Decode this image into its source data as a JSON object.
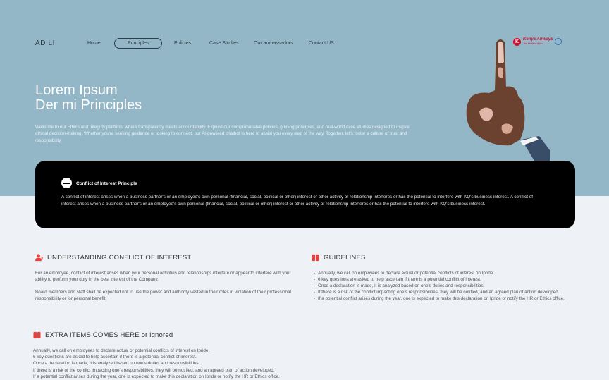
{
  "brand": "ADILI",
  "nav": {
    "items": [
      "Home",
      "Principles",
      "Policies",
      "Case Studies",
      "Our ambassadors",
      "Contact US"
    ],
    "active": "Principles"
  },
  "logo": {
    "text": "Kenya Airways",
    "tagline": "The Pride of Africa"
  },
  "hero": {
    "title_line1": "Lorem Ipsum",
    "title_line2": "Der mi Principles",
    "description": "Welcome to our Ethics and Integrity platform, where transparency meets accountability. Explore our comprehensive policies, guiding principles, and real-world case studies designed to inspire ethical decision-making. Whether you're seeking guidance or looking to connect, our AI-powered chatbot is here to assist you every step of the way. Together, let's foster a culture of trust and responsibility."
  },
  "principle_card": {
    "title": "Conflict of Interest Principle",
    "body": "A conflict of interest arises when a business partner's or an employee's own personal (financial, social, political or other) interest or other activity or relationship interferes or has the potential to interfere with KQ's business interest. A conflict of interest arises when a business partner's or an employee's own personal (financial, social, political or other) interest or other activity or relationship interferes or has the potential to interfere with KQ's business interest."
  },
  "understanding": {
    "title": "UNDERSTANDING CONFLICT OF INTEREST",
    "paragraph1": "For an employee, conflict of interest arises when your personal activities and relationships interfere or appear to interfere with your ability to perform your duty in the best interest of the Company.",
    "paragraph2": "Board members and staff shall be expected not to use the power and authority vested in their roles in violation of their professional responsibility or for personal benefit."
  },
  "guidelines": {
    "title": "GUIDELINES",
    "items": [
      "Annually, we call on employees to declare actual or potential conflicts of interest on Ipride.",
      "6 key questions are asked to help ascertain if there is a potential conflict of interest.",
      "Once a declaration is made, it is analyzed based on one's duties and responsibilities.",
      "If there is a risk of the conflict impacting one's responsibilities, they will be notified, and an agreed plan of action developed.",
      "If a potential conflict arises during the year, one is expected to make this declaration on Ipride or notify the HR or Ethics office."
    ]
  },
  "extra": {
    "title": "EXTRA ITEMS COMES HERE or ignored",
    "items": [
      "Annually, we call on employees to declare actual or potential conflicts of interest on Ipride.",
      "6 key questions are asked to help ascertain if there is a potential conflict of interest.",
      "Once a declaration is made, it is analyzed based on one's duties and responsibilities.",
      "If there is a risk of the conflict impacting one's responsibilities, they will be notified, and an agreed plan of action developed.",
      "If a potential conflict arises during the year, one is expected to make this declaration on Ipride or notify the HR or Ethics office."
    ]
  },
  "colors": {
    "hero_bg": "#94b7c8",
    "accent": "#e8413b",
    "card_bg": "#000000",
    "page_bg": "#eef1f6"
  }
}
